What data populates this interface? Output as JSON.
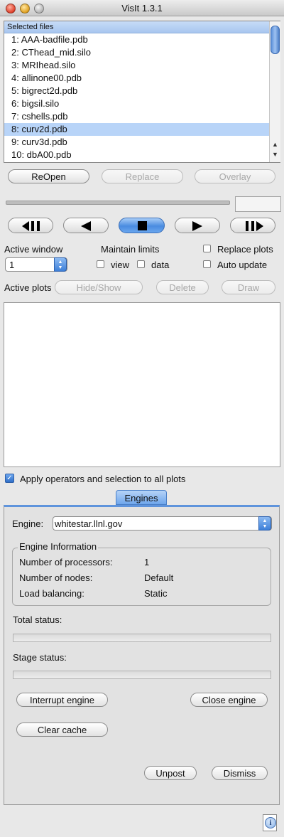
{
  "window": {
    "title": "VisIt 1.3.1"
  },
  "file_list": {
    "header": "Selected files",
    "items": [
      "1: AAA-badfile.pdb",
      "2: CThead_mid.silo",
      "3: MRIhead.silo",
      "4: allinone00.pdb",
      "5: bigrect2d.pdb",
      "6: bigsil.silo",
      "7: cshells.pdb",
      "8: curv2d.pdb",
      "9: curv3d.pdb",
      "10: dbA00.pdb"
    ],
    "selected_index": 7
  },
  "file_buttons": {
    "reopen": "ReOpen",
    "replace": "Replace",
    "overlay": "Overlay"
  },
  "vcr": {
    "icons": [
      "step-back-icon",
      "play-reverse-icon",
      "stop-icon",
      "play-icon",
      "step-forward-icon"
    ],
    "active": "stop-icon"
  },
  "window_controls": {
    "active_window_label": "Active window",
    "active_window_value": "1",
    "maintain_limits_label": "Maintain limits",
    "view_label": "view",
    "data_label": "data",
    "replace_plots_label": "Replace plots",
    "auto_update_label": "Auto update"
  },
  "plots": {
    "label": "Active plots",
    "hide_show": "Hide/Show",
    "delete": "Delete",
    "draw": "Draw"
  },
  "apply_ops": {
    "label": "Apply operators and selection to all plots",
    "checked": true
  },
  "engines": {
    "tab": "Engines",
    "engine_label": "Engine:",
    "engine_value": "whitestar.llnl.gov",
    "info_title": "Engine Information",
    "rows": [
      {
        "label": "Number of processors:",
        "value": "1"
      },
      {
        "label": "Number of nodes:",
        "value": "Default"
      },
      {
        "label": "Load balancing:",
        "value": "Static"
      }
    ],
    "total_status": "Total status:",
    "stage_status": "Stage status:",
    "interrupt": "Interrupt engine",
    "close": "Close engine",
    "clear_cache": "Clear cache",
    "unpost": "Unpost",
    "dismiss": "Dismiss"
  },
  "colors": {
    "accent": "#4a8ce0",
    "selection": "#b8d4f8"
  }
}
